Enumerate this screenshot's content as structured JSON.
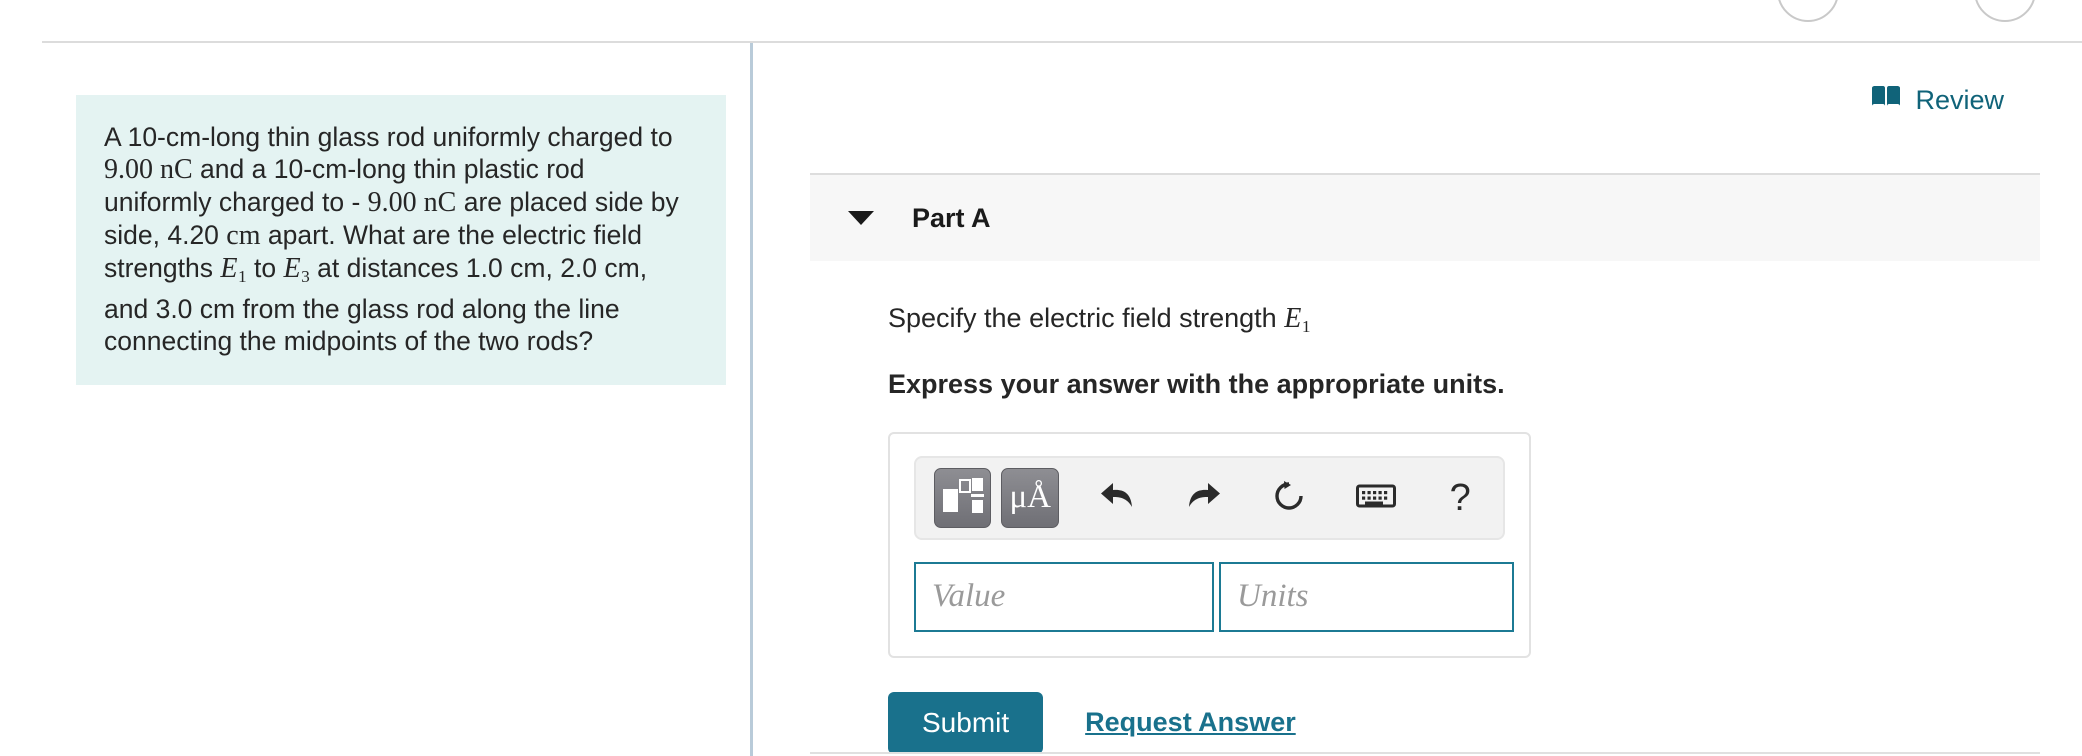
{
  "window": {
    "top_buttons": [
      {
        "name": "circle-button-1"
      },
      {
        "name": "circle-button-2"
      }
    ]
  },
  "question": {
    "segments": [
      {
        "type": "text",
        "value": "A 10-cm-long thin glass rod uniformly charged to "
      },
      {
        "type": "math_rm",
        "value": "9.00 nC"
      },
      {
        "type": "text",
        "value": " and a 10-cm-long thin plastic rod uniformly charged to - "
      },
      {
        "type": "math_rm",
        "value": "9.00 nC"
      },
      {
        "type": "text",
        "value": " are placed side by side, 4.20 "
      },
      {
        "type": "math_rm",
        "value": "cm"
      },
      {
        "type": "text",
        "value": " apart. What are the electric field strengths "
      },
      {
        "type": "math_it",
        "value": "E",
        "sub": "1"
      },
      {
        "type": "text",
        "value": " to "
      },
      {
        "type": "math_it",
        "value": "E",
        "sub": "3"
      },
      {
        "type": "text",
        "value": " at distances 1.0 cm, 2.0 cm, and 3.0 cm from the glass rod along the line connecting the midpoints of the two rods?"
      }
    ],
    "plain_text": "A 10-cm-long thin glass rod uniformly charged to 9.00 nC and a 10-cm-long thin plastic rod uniformly charged to - 9.00 nC are placed side by side, 4.20 cm apart. What are the electric field strengths E1 to E3 at distances 1.0 cm, 2.0 cm, and 3.0 cm from the glass rod along the line connecting the midpoints of the two rods?",
    "background_color": "#e4f3f2"
  },
  "review": {
    "label": "Review",
    "icon": "book-icon",
    "color": "#106379"
  },
  "part": {
    "title": "Part A",
    "caret_icon": "chevron-down-icon",
    "expanded": true,
    "prompt_prefix": "Specify the electric field strength ",
    "prompt_symbol": "E",
    "prompt_subscript": "1",
    "instruction": "Express your answer with the appropriate units."
  },
  "answer_widget": {
    "toolbar": [
      {
        "name": "template-button",
        "icon": "math-template-icon",
        "style": "gray"
      },
      {
        "name": "units-button",
        "icon": "micro-angstrom-icon",
        "label": "μÅ",
        "style": "gray"
      },
      {
        "name": "undo-button",
        "icon": "undo-arrow-icon",
        "style": "plain"
      },
      {
        "name": "redo-button",
        "icon": "redo-arrow-icon",
        "style": "plain"
      },
      {
        "name": "reset-button",
        "icon": "refresh-circle-icon",
        "style": "plain"
      },
      {
        "name": "keyboard-button",
        "icon": "keyboard-icon",
        "style": "plain"
      },
      {
        "name": "help-button",
        "icon": "question-mark-icon",
        "label": "?",
        "style": "plain"
      }
    ],
    "value_field": {
      "value": "",
      "placeholder": "Value"
    },
    "units_field": {
      "value": "",
      "placeholder": "Units"
    },
    "border_color": "#1c7a94"
  },
  "actions": {
    "submit_label": "Submit",
    "submit_color": "#19718c",
    "request_answer_label": "Request Answer",
    "request_answer_color": "#19718c"
  }
}
